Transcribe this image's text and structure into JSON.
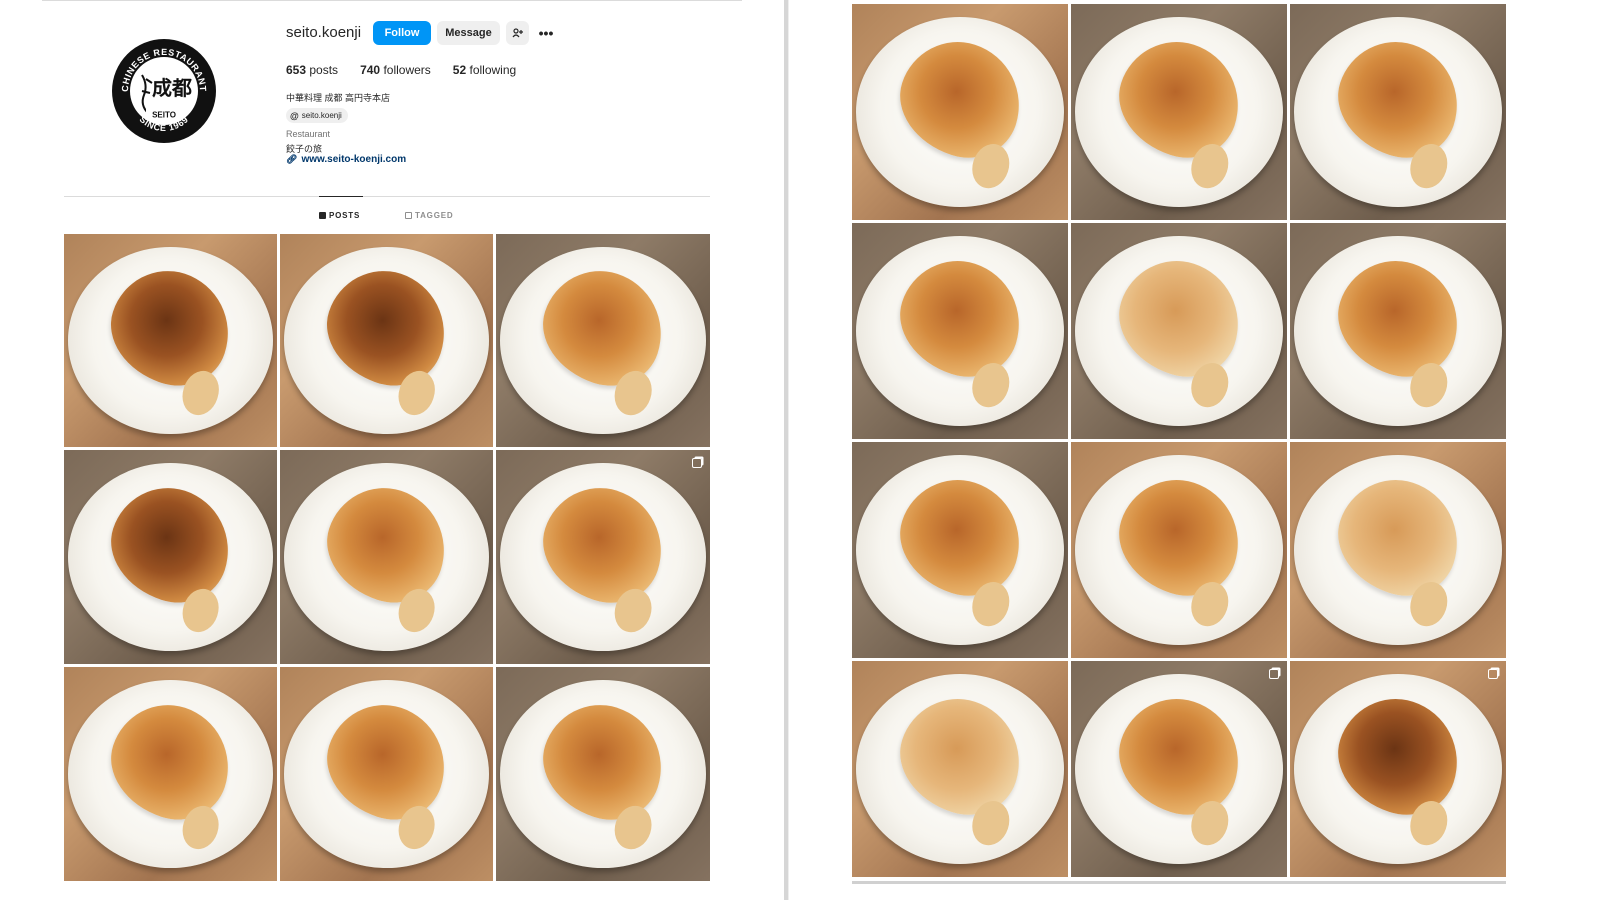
{
  "profile": {
    "username": "seito.koenji",
    "follow_label": "Follow",
    "message_label": "Message",
    "more_label": "•••",
    "stats": {
      "posts_count": "653",
      "posts_label": "posts",
      "followers_count": "740",
      "followers_label": "followers",
      "following_count": "52",
      "following_label": "following"
    },
    "bio_name": "中華料理 成都 高円寺本店",
    "threads_handle": "seito.koenji",
    "category": "Restaurant",
    "bio_line": "餃子の旅",
    "website": "www.seito-koenji.com",
    "logo": {
      "top_text": "CHINESE RESTAURANT",
      "kanji": "成都",
      "name": "SEITO",
      "since": "SINCE 1969"
    }
  },
  "tabs": [
    {
      "label": "POSTS",
      "active": true
    },
    {
      "label": "TAGGED",
      "active": false
    }
  ],
  "colors": {
    "accent": "#0095f6",
    "link": "#00376b",
    "muted": "#737373"
  },
  "icons": {
    "add_user": "add-person-icon",
    "more": "more-options-icon",
    "threads": "threads-icon",
    "link": "link-icon",
    "grid": "grid-icon",
    "tagged": "tagged-icon",
    "carousel": "carousel-icon"
  }
}
